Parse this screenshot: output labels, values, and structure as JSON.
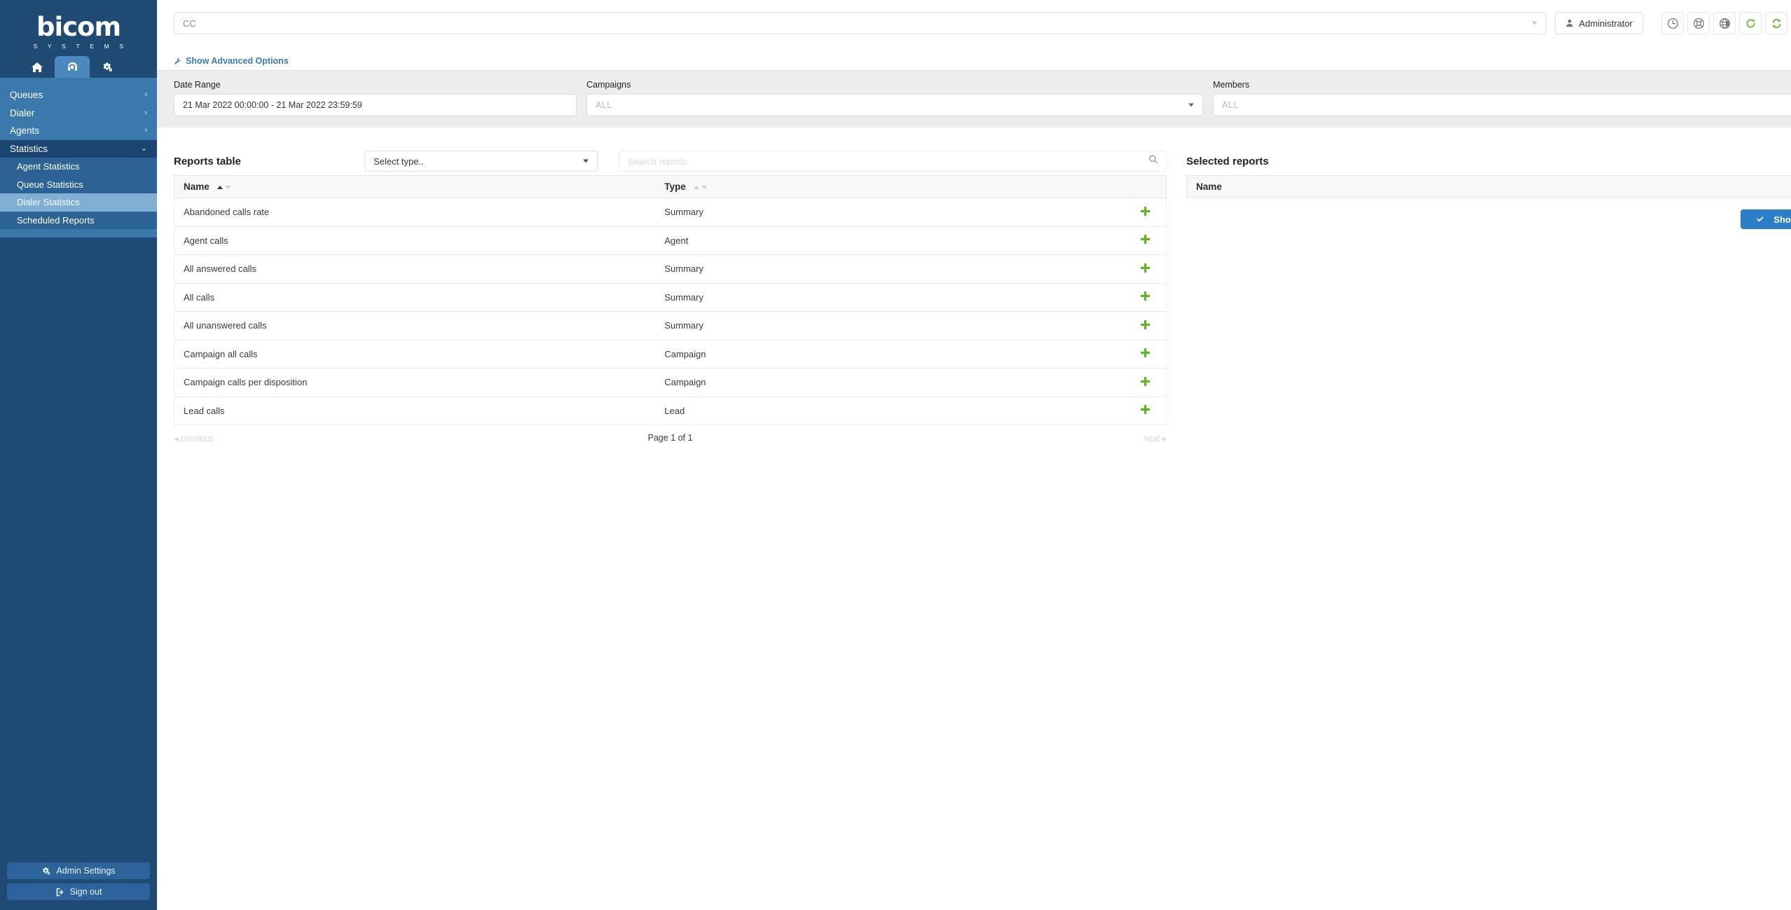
{
  "brand": {
    "name": "bicom",
    "subtitle": "S Y S T E M S"
  },
  "sidebar": {
    "tabs": [
      {
        "icon": "home-icon",
        "active": false
      },
      {
        "icon": "headset-icon",
        "active": true
      },
      {
        "icon": "gears-icon",
        "active": false
      }
    ],
    "nav": [
      {
        "label": "Queues",
        "chevron": "›",
        "expanded": false
      },
      {
        "label": "Dialer",
        "chevron": "›",
        "expanded": false
      },
      {
        "label": "Agents",
        "chevron": "›",
        "expanded": false
      },
      {
        "label": "Statistics",
        "chevron": "⌄",
        "expanded": true
      }
    ],
    "subnav": [
      {
        "label": "Agent Statistics",
        "active": false
      },
      {
        "label": "Queue Statistics",
        "active": false
      },
      {
        "label": "Dialer Statistics",
        "active": true
      },
      {
        "label": "Scheduled Reports",
        "active": false
      }
    ],
    "bottom": [
      {
        "label": "Admin Settings",
        "icon": "gears-icon"
      },
      {
        "label": "Sign out",
        "icon": "sign-out-icon"
      }
    ]
  },
  "topbar": {
    "cc_value": "CC",
    "admin_label": "Administrator",
    "icons": [
      {
        "name": "clock-icon",
        "color": "#6d6d6d"
      },
      {
        "name": "life-ring-icon",
        "color": "#6d6d6d"
      },
      {
        "name": "globe-icon",
        "color": "#6d6d6d"
      },
      {
        "name": "refresh-icon",
        "color": "#62b12c"
      },
      {
        "name": "sync-icon",
        "color": "#62b12c"
      },
      {
        "name": "bell-icon",
        "color": "#6d6d6d"
      }
    ],
    "advanced_options": "Show Advanced Options"
  },
  "filters": {
    "date_range": {
      "label": "Date Range",
      "value": "21 Mar 2022 00:00:00 - 21 Mar 2022 23:59:59"
    },
    "campaigns": {
      "label": "Campaigns",
      "value": "ALL"
    },
    "members": {
      "label": "Members",
      "value": "ALL"
    }
  },
  "reports": {
    "title": "Reports table",
    "type_select": "Select type..",
    "search_placeholder": "Search reports",
    "search_value": "",
    "columns": [
      {
        "label": "Name",
        "sort_asc": true,
        "sort_desc": false
      },
      {
        "label": "Type",
        "sort_asc": false,
        "sort_desc": false
      }
    ],
    "rows": [
      {
        "name": "Abandoned calls rate",
        "type": "Summary",
        "add": "add-icon"
      },
      {
        "name": "Agent calls",
        "type": "Agent",
        "add": "add-icon"
      },
      {
        "name": "All answered calls",
        "type": "Summary",
        "add": "add-icon"
      },
      {
        "name": "All calls",
        "type": "Summary",
        "add": "add-icon"
      },
      {
        "name": "All unanswered calls",
        "type": "Summary",
        "add": "add-icon"
      },
      {
        "name": "Campaign all calls",
        "type": "Campaign",
        "add": "add-icon"
      },
      {
        "name": "Campaign calls per disposition",
        "type": "Campaign",
        "add": "add-icon"
      },
      {
        "name": "Lead calls",
        "type": "Lead",
        "add": "add-icon"
      }
    ],
    "pagination": {
      "previous": "previous",
      "page_info": "Page 1 of 1",
      "next": "next"
    }
  },
  "selected": {
    "title": "Selected reports",
    "column": "Name",
    "rows": [],
    "show_label": "Show"
  },
  "colors": {
    "accent": "#2b7fc9",
    "green": "#62b12c",
    "sidebar": "#1f4a74",
    "nav": "#3b79ad"
  }
}
